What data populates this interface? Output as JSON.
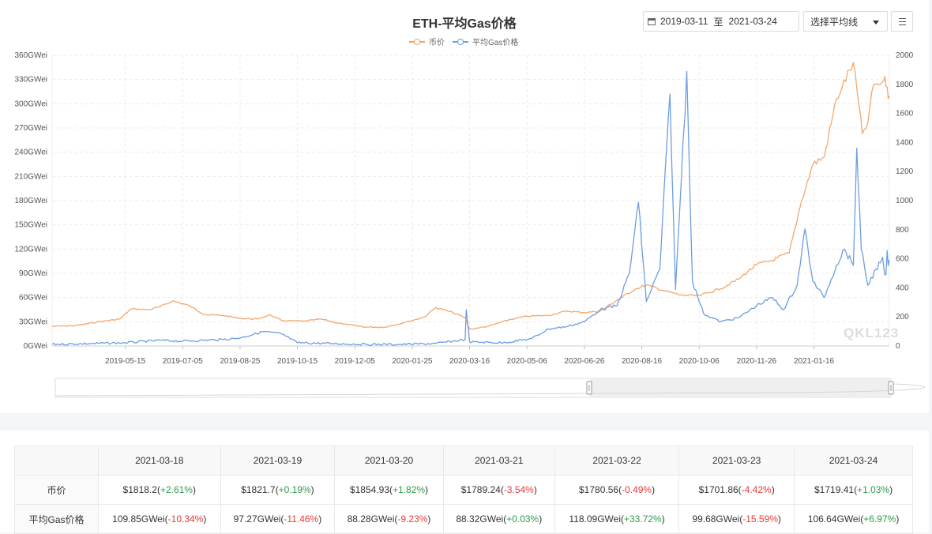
{
  "toolbar": {
    "date_from": "2019-03-11",
    "date_separator": "至",
    "date_to": "2021-03-24",
    "moving_average_select": "选择平均线",
    "calendar_icon": "calendar-icon",
    "menu_icon": "hamburger-menu-icon"
  },
  "watermark": "QKL123",
  "colors": {
    "price": "#f4a66a",
    "gas": "#6c9ee0"
  },
  "chart_data": {
    "type": "line",
    "title": "ETH-平均Gas价格",
    "legend_position": "top-center",
    "grid": true,
    "x_ticks": [
      "2019-05-15",
      "2019-07-05",
      "2019-08-25",
      "2019-10-15",
      "2019-12-05",
      "2020-01-25",
      "2020-03-16",
      "2020-05-06",
      "2020-06-26",
      "2020-08-16",
      "2020-10-06",
      "2020-11-26",
      "2021-01-16"
    ],
    "y_left": {
      "ticks": [
        "0GWei",
        "30GWei",
        "60GWei",
        "90GWei",
        "120GWei",
        "150GWei",
        "180GWei",
        "210GWei",
        "240GWei",
        "270GWei",
        "300GWei",
        "330GWei",
        "360GWei"
      ],
      "range": [
        0,
        360
      ],
      "unit": "GWei"
    },
    "y_right": {
      "ticks": [
        "0",
        "200",
        "400",
        "600",
        "800",
        "1000",
        "1200",
        "1400",
        "1600",
        "1800",
        "2000"
      ],
      "range": [
        0,
        2000
      ]
    },
    "series": [
      {
        "name": "币价",
        "axis": "right",
        "points": [
          [
            "2019-03-11",
            135
          ],
          [
            "2019-04-01",
            140
          ],
          [
            "2019-04-20",
            165
          ],
          [
            "2019-05-10",
            185
          ],
          [
            "2019-05-20",
            255
          ],
          [
            "2019-06-05",
            250
          ],
          [
            "2019-06-15",
            270
          ],
          [
            "2019-06-26",
            310
          ],
          [
            "2019-07-10",
            280
          ],
          [
            "2019-07-25",
            215
          ],
          [
            "2019-08-10",
            210
          ],
          [
            "2019-08-25",
            190
          ],
          [
            "2019-09-10",
            185
          ],
          [
            "2019-09-20",
            215
          ],
          [
            "2019-10-01",
            175
          ],
          [
            "2019-10-20",
            170
          ],
          [
            "2019-11-05",
            185
          ],
          [
            "2019-11-25",
            150
          ],
          [
            "2019-12-15",
            130
          ],
          [
            "2020-01-01",
            130
          ],
          [
            "2020-01-20",
            165
          ],
          [
            "2020-02-05",
            200
          ],
          [
            "2020-02-15",
            265
          ],
          [
            "2020-03-01",
            230
          ],
          [
            "2020-03-12",
            195
          ],
          [
            "2020-03-16",
            115
          ],
          [
            "2020-04-01",
            135
          ],
          [
            "2020-04-20",
            180
          ],
          [
            "2020-05-06",
            205
          ],
          [
            "2020-05-25",
            210
          ],
          [
            "2020-06-10",
            240
          ],
          [
            "2020-06-26",
            230
          ],
          [
            "2020-07-10",
            240
          ],
          [
            "2020-07-25",
            315
          ],
          [
            "2020-08-10",
            390
          ],
          [
            "2020-08-20",
            420
          ],
          [
            "2020-09-05",
            380
          ],
          [
            "2020-09-20",
            350
          ],
          [
            "2020-10-06",
            345
          ],
          [
            "2020-10-25",
            395
          ],
          [
            "2020-11-10",
            460
          ],
          [
            "2020-11-26",
            560
          ],
          [
            "2020-12-10",
            590
          ],
          [
            "2020-12-25",
            640
          ],
          [
            "2021-01-05",
            1000
          ],
          [
            "2021-01-15",
            1250
          ],
          [
            "2021-01-25",
            1300
          ],
          [
            "2021-02-05",
            1700
          ],
          [
            "2021-02-10",
            1780
          ],
          [
            "2021-02-20",
            1950
          ],
          [
            "2021-02-28",
            1460
          ],
          [
            "2021-03-05",
            1540
          ],
          [
            "2021-03-10",
            1800
          ],
          [
            "2021-03-16",
            1800
          ],
          [
            "2021-03-18",
            1818.2
          ],
          [
            "2021-03-19",
            1821.7
          ],
          [
            "2021-03-20",
            1854.93
          ],
          [
            "2021-03-21",
            1789.24
          ],
          [
            "2021-03-22",
            1780.56
          ],
          [
            "2021-03-23",
            1701.86
          ],
          [
            "2021-03-24",
            1719.41
          ]
        ]
      },
      {
        "name": "平均Gas价格",
        "axis": "left",
        "points": [
          [
            "2019-03-11",
            2
          ],
          [
            "2019-04-15",
            3
          ],
          [
            "2019-05-15",
            4
          ],
          [
            "2019-06-15",
            7
          ],
          [
            "2019-07-05",
            6
          ],
          [
            "2019-08-10",
            8
          ],
          [
            "2019-08-25",
            10
          ],
          [
            "2019-09-15",
            18
          ],
          [
            "2019-10-01",
            15
          ],
          [
            "2019-10-15",
            4
          ],
          [
            "2019-11-15",
            3
          ],
          [
            "2019-12-15",
            2
          ],
          [
            "2020-01-15",
            2
          ],
          [
            "2020-02-15",
            3
          ],
          [
            "2020-03-12",
            8
          ],
          [
            "2020-03-13",
            45
          ],
          [
            "2020-03-16",
            5
          ],
          [
            "2020-04-15",
            4
          ],
          [
            "2020-05-10",
            9
          ],
          [
            "2020-05-25",
            21
          ],
          [
            "2020-06-10",
            24
          ],
          [
            "2020-06-26",
            30
          ],
          [
            "2020-07-10",
            45
          ],
          [
            "2020-07-25",
            50
          ],
          [
            "2020-08-05",
            90
          ],
          [
            "2020-08-13",
            178
          ],
          [
            "2020-08-20",
            55
          ],
          [
            "2020-09-01",
            95
          ],
          [
            "2020-09-10",
            312
          ],
          [
            "2020-09-15",
            70
          ],
          [
            "2020-09-25",
            340
          ],
          [
            "2020-09-30",
            80
          ],
          [
            "2020-10-10",
            40
          ],
          [
            "2020-10-25",
            30
          ],
          [
            "2020-11-10",
            35
          ],
          [
            "2020-11-26",
            50
          ],
          [
            "2020-12-10",
            60
          ],
          [
            "2020-12-20",
            45
          ],
          [
            "2021-01-01",
            75
          ],
          [
            "2021-01-08",
            145
          ],
          [
            "2021-01-15",
            80
          ],
          [
            "2021-01-25",
            60
          ],
          [
            "2021-02-05",
            100
          ],
          [
            "2021-02-12",
            120
          ],
          [
            "2021-02-20",
            100
          ],
          [
            "2021-02-23",
            245
          ],
          [
            "2021-02-27",
            120
          ],
          [
            "2021-03-05",
            75
          ],
          [
            "2021-03-12",
            95
          ],
          [
            "2021-03-16",
            103
          ],
          [
            "2021-03-18",
            109.85
          ],
          [
            "2021-03-19",
            97.27
          ],
          [
            "2021-03-20",
            88.28
          ],
          [
            "2021-03-21",
            88.32
          ],
          [
            "2021-03-22",
            118.09
          ],
          [
            "2021-03-23",
            99.68
          ],
          [
            "2021-03-24",
            106.64
          ]
        ]
      }
    ]
  },
  "table": {
    "dates": [
      "2021-03-18",
      "2021-03-19",
      "2021-03-20",
      "2021-03-21",
      "2021-03-22",
      "2021-03-23",
      "2021-03-24"
    ],
    "rows": [
      {
        "label": "币价",
        "cells": [
          {
            "value": "$1818.2",
            "change": "+2.61%",
            "dir": "up"
          },
          {
            "value": "$1821.7",
            "change": "+0.19%",
            "dir": "up"
          },
          {
            "value": "$1854.93",
            "change": "+1.82%",
            "dir": "up"
          },
          {
            "value": "$1789.24",
            "change": "-3.54%",
            "dir": "down"
          },
          {
            "value": "$1780.56",
            "change": "-0.49%",
            "dir": "down"
          },
          {
            "value": "$1701.86",
            "change": "-4.42%",
            "dir": "down"
          },
          {
            "value": "$1719.41",
            "change": "+1.03%",
            "dir": "up"
          }
        ]
      },
      {
        "label": "平均Gas价格",
        "cells": [
          {
            "value": "109.85GWei",
            "change": "-10.34%",
            "dir": "down"
          },
          {
            "value": "97.27GWei",
            "change": "-11.46%",
            "dir": "down"
          },
          {
            "value": "88.28GWei",
            "change": "-9.23%",
            "dir": "down"
          },
          {
            "value": "88.32GWei",
            "change": "+0.03%",
            "dir": "up"
          },
          {
            "value": "118.09GWei",
            "change": "+33.72%",
            "dir": "up"
          },
          {
            "value": "99.68GWei",
            "change": "-15.59%",
            "dir": "down"
          },
          {
            "value": "106.64GWei",
            "change": "+6.97%",
            "dir": "up"
          }
        ]
      }
    ]
  }
}
